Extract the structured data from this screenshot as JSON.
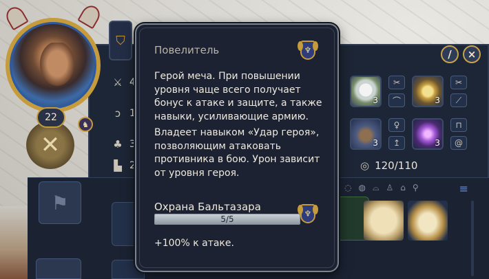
{
  "hero": {
    "level": "22"
  },
  "stats": [
    {
      "icon": "swords-icon",
      "value": "4"
    },
    {
      "icon": "shield-icon",
      "value": "1"
    },
    {
      "icon": "clover-icon",
      "value": "3"
    },
    {
      "icon": "boot-icon",
      "value": "2"
    }
  ],
  "army": {
    "count": "120/110",
    "slots": [
      {
        "name": "dove",
        "count": "3"
      },
      {
        "name": "sword",
        "count": "3"
      },
      {
        "name": "soldiers",
        "count": "3"
      },
      {
        "name": "orb",
        "count": "3"
      }
    ]
  },
  "tooltip": {
    "title": "Повелитель",
    "description": [
      "Герой меча. При повышении уровня чаще всего получает бонус к атаке и защите, а также навыки, усиливающие армию.",
      "Владеет навыком «Удар героя», позволяющим атаковать противника в бою. Урон зависит от уровня героя."
    ],
    "guard_title": "Охрана Бальтазара",
    "progress_text": "5/5",
    "progress_fraction": 1.0,
    "bonus": "+100% к атаке."
  },
  "colors": {
    "panel": "#1d2636",
    "tooltip_bg": "#1c2231",
    "gold": "#c59b3c",
    "accent_blue": "#2e3c7a"
  }
}
